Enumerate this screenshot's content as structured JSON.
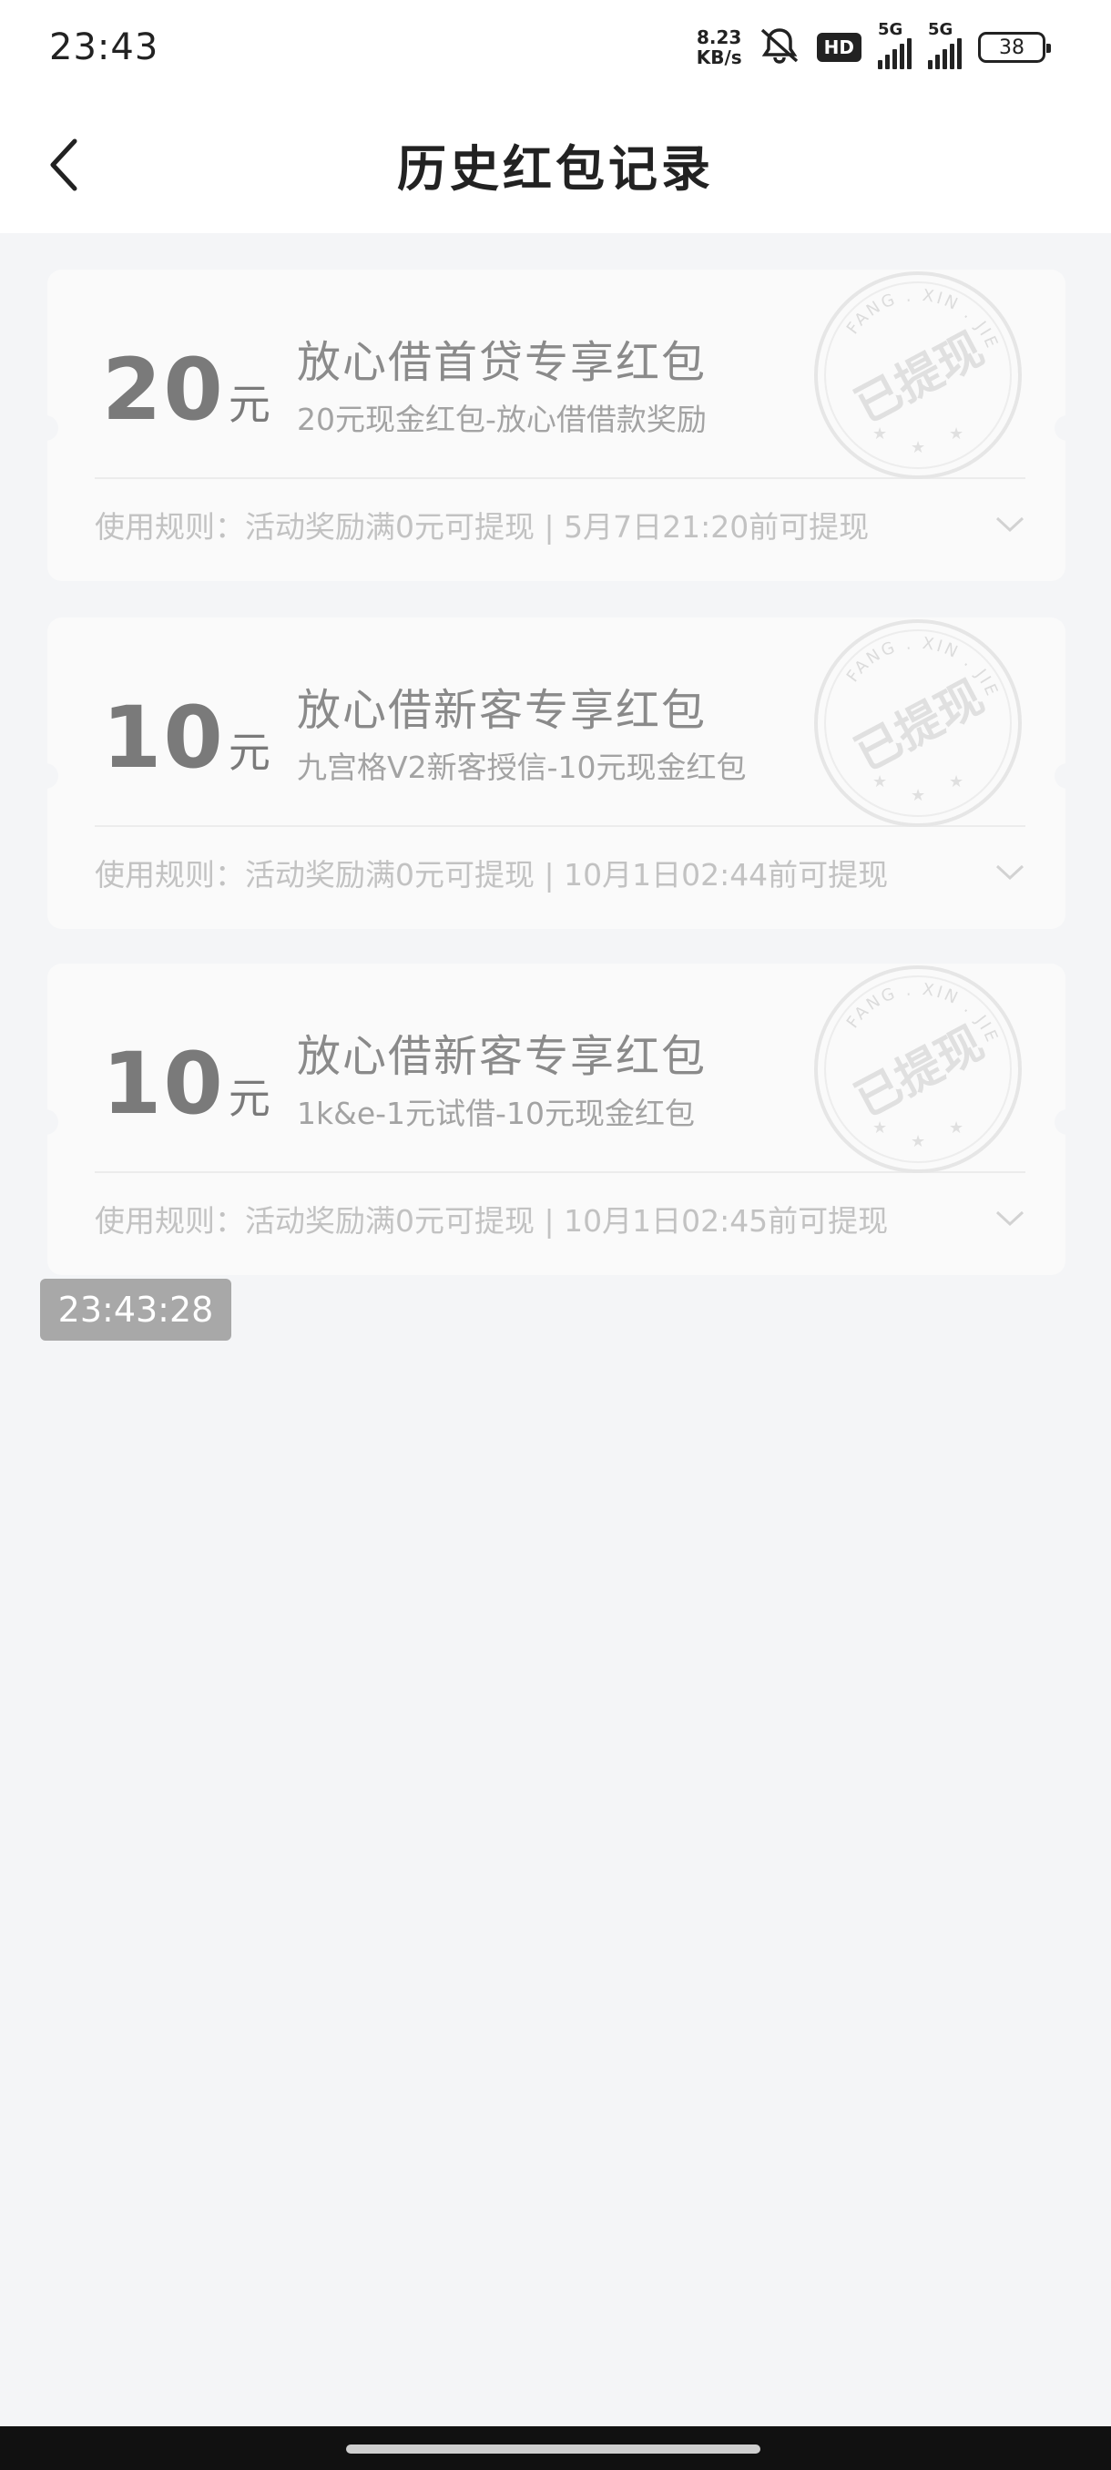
{
  "status_bar": {
    "time": "23:43",
    "net_speed_value": "8.23",
    "net_speed_unit": "KB/s",
    "hd_label": "HD",
    "sim1_label": "5G",
    "sim2_label": "5G",
    "battery_level": "38",
    "icons": [
      "mute-bell-icon",
      "signal-icon",
      "battery-icon"
    ]
  },
  "header": {
    "title": "历史红包记录",
    "back_icon": "chevron-left-icon"
  },
  "records": [
    {
      "amount": "20",
      "unit": "元",
      "title": "放心借首贷专享红包",
      "subtitle": "20元现金红包-放心借借款奖励",
      "rule": "使用规则：活动奖励满0元可提现 | 5月7日21:20前可提现",
      "stamp_text": "已提现",
      "stamp_arc": "FANG . XIN . JIE"
    },
    {
      "amount": "10",
      "unit": "元",
      "title": "放心借新客专享红包",
      "subtitle": "九宫格V2新客授信-10元现金红包",
      "rule": "使用规则：活动奖励满0元可提现 | 10月1日02:44前可提现",
      "stamp_text": "已提现",
      "stamp_arc": "FANG . XIN . JIE"
    },
    {
      "amount": "10",
      "unit": "元",
      "title": "放心借新客专享红包",
      "subtitle": "1k&e-1元试借-10元现金红包",
      "rule": "使用规则：活动奖励满0元可提现 | 10月1日02:45前可提现",
      "stamp_text": "已提现",
      "stamp_arc": "FANG . XIN . JIE"
    }
  ],
  "overlay_time": "23:43:28",
  "colors": {
    "background": "#f4f5f7",
    "card": "#fafafa",
    "text_muted": "#a3a3a3",
    "time_badge": "#a8a8a8"
  }
}
